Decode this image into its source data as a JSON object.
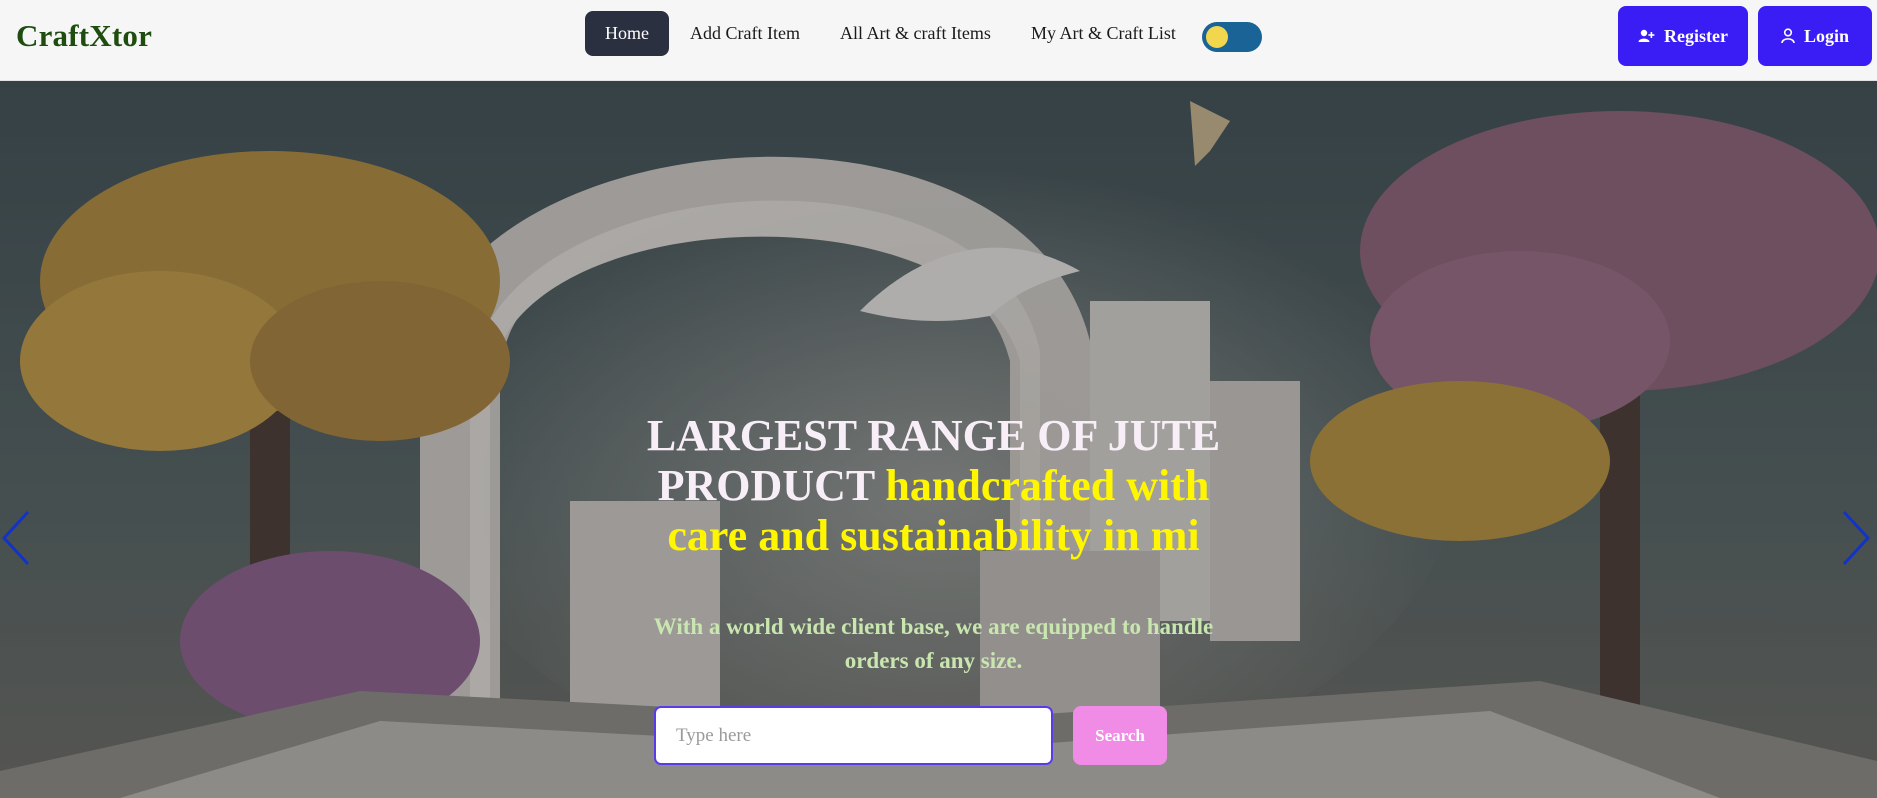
{
  "brand": "CraftXtor",
  "nav": {
    "items": [
      {
        "label": "Home",
        "active": true
      },
      {
        "label": "Add Craft Item",
        "active": false
      },
      {
        "label": "All Art & craft Items",
        "active": false
      },
      {
        "label": "My Art & Craft List",
        "active": false
      }
    ],
    "theme_toggle_icon": "toggle-switch"
  },
  "auth": {
    "register_label": "Register",
    "register_icon": "user-plus-icon",
    "login_label": "Login",
    "login_icon": "user-icon",
    "button_color": "#3a1cf5"
  },
  "hero": {
    "title_plain": "LARGEST RANGE OF JUTE PRODUCT ",
    "title_accent": "handcrafted with care and sustainability in mi",
    "subtitle": "With a world wide client base, we are equipped to handle orders of any size.",
    "accent_color": "#fff600",
    "search": {
      "placeholder": "Type here",
      "value": "",
      "button_label": "Search",
      "button_color": "#f08ce6"
    },
    "prev_icon": "chevron-left-icon",
    "next_icon": "chevron-right-icon"
  }
}
